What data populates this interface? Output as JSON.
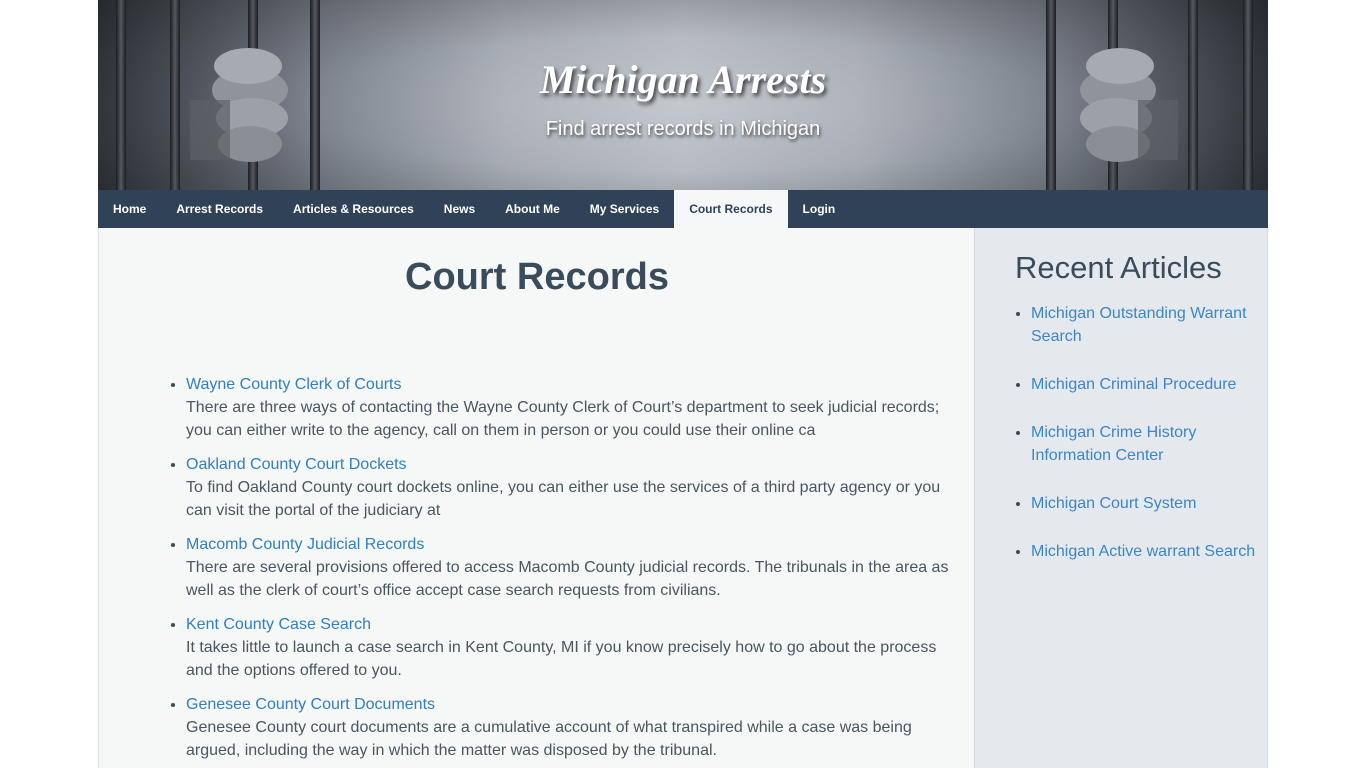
{
  "header": {
    "site_title": "Michigan Arrests",
    "tagline": "Find arrest records in Michigan"
  },
  "nav": {
    "items": [
      {
        "label": "Home"
      },
      {
        "label": "Arrest Records"
      },
      {
        "label": "Articles & Resources"
      },
      {
        "label": "News"
      },
      {
        "label": "About Me"
      },
      {
        "label": "My Services"
      },
      {
        "label": "Court Records",
        "active": true
      },
      {
        "label": "Login"
      }
    ]
  },
  "main": {
    "title": "Court Records",
    "records": [
      {
        "link": "Wayne County Clerk of Courts",
        "desc": "There are three ways of contacting the Wayne County Clerk of Court’s department to seek judicial records; you can either write to the agency, call on them in person or you could use their online ca"
      },
      {
        "link": "Oakland County Court Dockets",
        "desc": "To find Oakland County court dockets online, you can either use the services of a third party agency or you can visit the portal of the judiciary at"
      },
      {
        "link": "Macomb County Judicial Records",
        "desc": "There are several provisions offered to access Macomb County judicial records. The tribunals in the area as well as the clerk of court’s office accept case search requests from civilians."
      },
      {
        "link": "Kent County Case Search",
        "desc": "It takes little to launch a case search in Kent County, MI if you know precisely how to go about the process and the options offered to you."
      },
      {
        "link": "Genesee County Court Documents",
        "desc": "Genesee County court documents are a cumulative account of what transpired while a case was being argued, including the way in which the matter was disposed by the tribunal."
      }
    ]
  },
  "sidebar": {
    "title": "Recent Articles",
    "items": [
      {
        "label": "Michigan Outstanding Warrant Search"
      },
      {
        "label": "Michigan Criminal Procedure"
      },
      {
        "label": "Michigan Crime History Information Center"
      },
      {
        "label": "Michigan Court System"
      },
      {
        "label": "Michigan Active warrant Search"
      }
    ]
  },
  "colors": {
    "nav_bg": "#2f4257",
    "link": "#2f7fc1",
    "heading": "#3a4b5c",
    "sidebar_bg": "#e5e9ed",
    "main_bg": "#f6f8f8"
  }
}
